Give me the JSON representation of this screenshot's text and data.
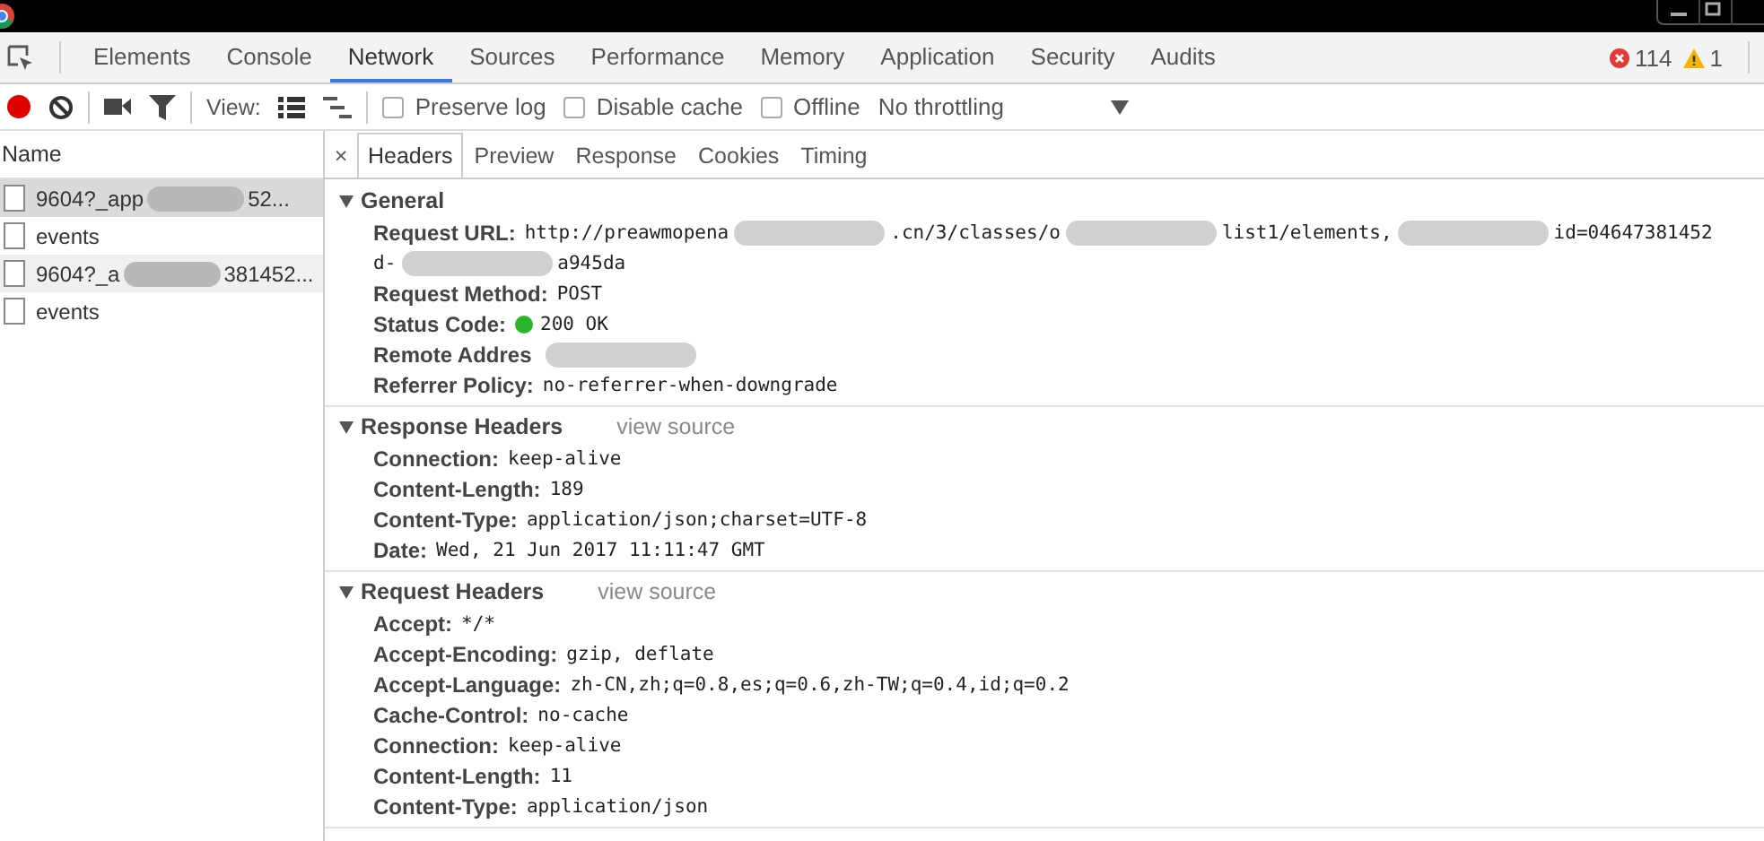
{
  "tabs": [
    {
      "label": "Elements",
      "selected": false
    },
    {
      "label": "Console",
      "selected": false
    },
    {
      "label": "Network",
      "selected": true
    },
    {
      "label": "Sources",
      "selected": false
    },
    {
      "label": "Performance",
      "selected": false
    },
    {
      "label": "Memory",
      "selected": false
    },
    {
      "label": "Application",
      "selected": false
    },
    {
      "label": "Security",
      "selected": false
    },
    {
      "label": "Audits",
      "selected": false
    }
  ],
  "counts": {
    "errors": "114",
    "warnings": "1"
  },
  "toolbar": {
    "recording": true,
    "view_label": "View:",
    "view_list_selected": true,
    "options": [
      {
        "label": "Preserve log",
        "checked": false
      },
      {
        "label": "Disable cache",
        "checked": false
      },
      {
        "label": "Offline",
        "checked": false
      }
    ],
    "throttling": "No throttling"
  },
  "requests": {
    "header": "Name",
    "rows": [
      {
        "name_start": "9604?_app",
        "name_end": "52...",
        "redacted": true,
        "selected": true
      },
      {
        "name_start": "events",
        "redacted": false,
        "selected": false
      },
      {
        "name_start": "9604?_a",
        "name_end": "381452...",
        "redacted": true,
        "selected": false
      },
      {
        "name_start": "events",
        "redacted": false,
        "selected": false
      }
    ]
  },
  "detail_tabs": {
    "close": "×",
    "tabs": [
      {
        "label": "Headers",
        "selected": true
      },
      {
        "label": "Preview",
        "selected": false
      },
      {
        "label": "Response",
        "selected": false
      },
      {
        "label": "Cookies",
        "selected": false
      },
      {
        "label": "Timing",
        "selected": false
      }
    ]
  },
  "sections": [
    {
      "title": "General",
      "expanded": true,
      "items": [
        {
          "kind": "url",
          "key": "Request URL:",
          "lines": [
            [
              "http://preawmopena",
              ".cn/3/classes/o",
              "list1/elements,",
              "id=04647381452"
            ],
            [
              "d-",
              "a945da"
            ]
          ]
        },
        {
          "kind": "text",
          "key": "Request Method:",
          "value": "POST"
        },
        {
          "kind": "status",
          "key": "Status Code:",
          "value": "200 OK",
          "color": "#2bb32b"
        },
        {
          "kind": "redacted",
          "key": "Remote Addres"
        },
        {
          "kind": "text",
          "key": "Referrer Policy:",
          "value": "no-referrer-when-downgrade"
        }
      ]
    },
    {
      "title": "Response Headers",
      "link": "view source",
      "expanded": true,
      "items": [
        {
          "kind": "text",
          "key": "Connection:",
          "value": "keep-alive"
        },
        {
          "kind": "text",
          "key": "Content-Length:",
          "value": "189"
        },
        {
          "kind": "text",
          "key": "Content-Type:",
          "value": "application/json;charset=UTF-8"
        },
        {
          "kind": "text",
          "key": "Date:",
          "value": "Wed, 21 Jun 2017 11:11:47 GMT"
        }
      ]
    },
    {
      "title": "Request Headers",
      "link": "view source",
      "expanded": true,
      "items": [
        {
          "kind": "text",
          "key": "Accept:",
          "value": "*/*"
        },
        {
          "kind": "text",
          "key": "Accept-Encoding:",
          "value": "gzip, deflate"
        },
        {
          "kind": "text",
          "key": "Accept-Language:",
          "value": "zh-CN,zh;q=0.8,es;q=0.6,zh-TW;q=0.4,id;q=0.2"
        },
        {
          "kind": "text",
          "key": "Cache-Control:",
          "value": "no-cache"
        },
        {
          "kind": "text",
          "key": "Connection:",
          "value": "keep-alive"
        },
        {
          "kind": "text",
          "key": "Content-Length:",
          "value": "11"
        },
        {
          "kind": "text",
          "key": "Content-Type:",
          "value": "application/json"
        }
      ]
    }
  ]
}
